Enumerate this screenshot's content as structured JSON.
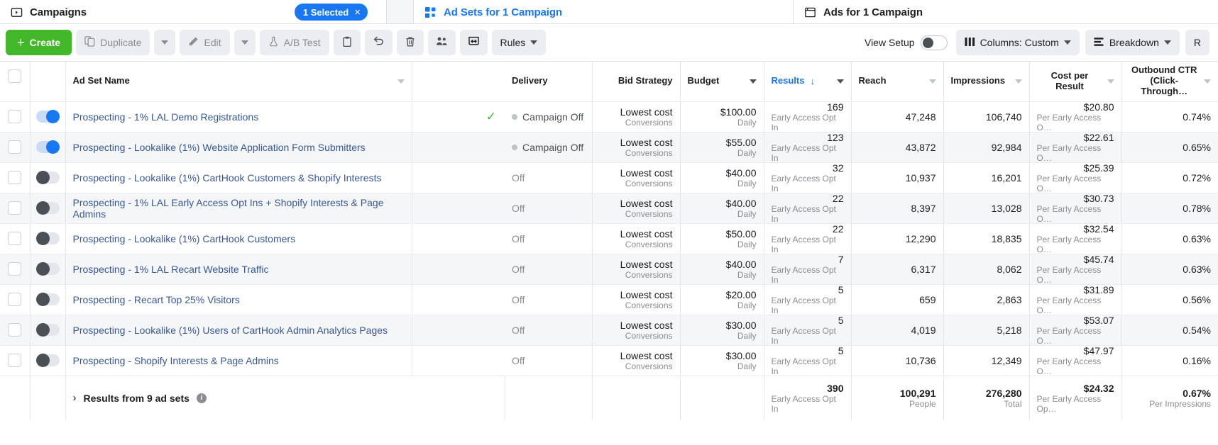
{
  "tabs": [
    {
      "id": "campaigns",
      "label": "Campaigns",
      "icon": "campaigns-icon",
      "selected_badge": "1 Selected",
      "close": "×"
    },
    {
      "id": "adsets",
      "label": "Ad Sets for 1 Campaign",
      "icon": "adsets-grid-icon"
    },
    {
      "id": "ads",
      "label": "Ads for 1 Campaign",
      "icon": "ads-icon"
    }
  ],
  "toolbar": {
    "create_label": "Create",
    "duplicate_label": "Duplicate",
    "edit_label": "Edit",
    "abtest_label": "A/B Test",
    "rules_label": "Rules",
    "icons": {
      "duplicate": "duplicate-icon",
      "edit": "pencil-icon",
      "abtest": "flask-icon",
      "clipboard": "clipboard-icon",
      "revert": "undo-arrow-icon",
      "delete": "trash-icon",
      "audience": "audience-icon",
      "export": "export-icon"
    },
    "view_setup_label": "View Setup",
    "columns_label": "Columns: Custom",
    "breakdown_label": "Breakdown",
    "reports_label": "R"
  },
  "table": {
    "columns": [
      {
        "key": "name",
        "label": "Ad Set Name",
        "align": "left",
        "caret": "dim"
      },
      {
        "key": "delivery",
        "label": "Delivery",
        "align": "left",
        "caret": "none"
      },
      {
        "key": "bid",
        "label": "Bid Strategy",
        "align": "right",
        "caret": "none"
      },
      {
        "key": "budget",
        "label": "Budget",
        "align": "left",
        "caret": "dark"
      },
      {
        "key": "results",
        "label": "Results",
        "align": "left",
        "caret": "dark",
        "sorted": "↓"
      },
      {
        "key": "reach",
        "label": "Reach",
        "align": "left",
        "caret": "dim"
      },
      {
        "key": "impressions",
        "label": "Impressions",
        "align": "left",
        "caret": "dim"
      },
      {
        "key": "cpr",
        "label": "Cost per Result",
        "align": "left",
        "caret": "dim"
      },
      {
        "key": "ctr",
        "label": "Outbound CTR (Click-Through…",
        "align": "left",
        "caret": "dim"
      }
    ],
    "rows": [
      {
        "toggle": "on",
        "checked": true,
        "name": "Prospecting - 1% LAL Demo Registrations",
        "delivery": "Campaign Off",
        "delivery_dot": true,
        "bid": "Lowest cost",
        "bid_sub": "Conversions",
        "budget": "$100.00",
        "budget_sub": "Daily",
        "results": "169",
        "results_sub": "Early Access Opt In",
        "reach": "47,248",
        "impressions": "106,740",
        "cpr": "$20.80",
        "cpr_sub": "Per Early Access O…",
        "ctr": "0.74%"
      },
      {
        "toggle": "on",
        "checked": false,
        "name": "Prospecting - Lookalike (1%) Website Application Form Submitters",
        "delivery": "Campaign Off",
        "delivery_dot": true,
        "bid": "Lowest cost",
        "bid_sub": "Conversions",
        "budget": "$55.00",
        "budget_sub": "Daily",
        "results": "123",
        "results_sub": "Early Access Opt In",
        "reach": "43,872",
        "impressions": "92,984",
        "cpr": "$22.61",
        "cpr_sub": "Per Early Access O…",
        "ctr": "0.65%"
      },
      {
        "toggle": "off",
        "checked": false,
        "name": "Prospecting - Lookalike (1%) CartHook Customers & Shopify Interests",
        "delivery": "Off",
        "delivery_dot": false,
        "bid": "Lowest cost",
        "bid_sub": "Conversions",
        "budget": "$40.00",
        "budget_sub": "Daily",
        "results": "32",
        "results_sub": "Early Access Opt In",
        "reach": "10,937",
        "impressions": "16,201",
        "cpr": "$25.39",
        "cpr_sub": "Per Early Access O…",
        "ctr": "0.72%"
      },
      {
        "toggle": "off",
        "checked": false,
        "name": "Prospecting - 1% LAL Early Access Opt Ins + Shopify Interests & Page Admins",
        "delivery": "Off",
        "delivery_dot": false,
        "bid": "Lowest cost",
        "bid_sub": "Conversions",
        "budget": "$40.00",
        "budget_sub": "Daily",
        "results": "22",
        "results_sub": "Early Access Opt In",
        "reach": "8,397",
        "impressions": "13,028",
        "cpr": "$30.73",
        "cpr_sub": "Per Early Access O…",
        "ctr": "0.78%"
      },
      {
        "toggle": "off",
        "checked": false,
        "name": "Prospecting - Lookalike (1%) CartHook Customers",
        "delivery": "Off",
        "delivery_dot": false,
        "bid": "Lowest cost",
        "bid_sub": "Conversions",
        "budget": "$50.00",
        "budget_sub": "Daily",
        "results": "22",
        "results_sub": "Early Access Opt In",
        "reach": "12,290",
        "impressions": "18,835",
        "cpr": "$32.54",
        "cpr_sub": "Per Early Access O…",
        "ctr": "0.63%"
      },
      {
        "toggle": "off",
        "checked": false,
        "name": "Prospecting - 1% LAL Recart Website Traffic",
        "delivery": "Off",
        "delivery_dot": false,
        "bid": "Lowest cost",
        "bid_sub": "Conversions",
        "budget": "$40.00",
        "budget_sub": "Daily",
        "results": "7",
        "results_sub": "Early Access Opt In",
        "reach": "6,317",
        "impressions": "8,062",
        "cpr": "$45.74",
        "cpr_sub": "Per Early Access O…",
        "ctr": "0.63%"
      },
      {
        "toggle": "off",
        "checked": false,
        "name": "Prospecting - Recart Top 25% Visitors",
        "delivery": "Off",
        "delivery_dot": false,
        "bid": "Lowest cost",
        "bid_sub": "Conversions",
        "budget": "$20.00",
        "budget_sub": "Daily",
        "results": "5",
        "results_sub": "Early Access Opt In",
        "reach": "659",
        "impressions": "2,863",
        "cpr": "$31.89",
        "cpr_sub": "Per Early Access O…",
        "ctr": "0.56%"
      },
      {
        "toggle": "off",
        "checked": false,
        "name": "Prospecting - Lookalike (1%) Users of CartHook Admin Analytics Pages",
        "delivery": "Off",
        "delivery_dot": false,
        "bid": "Lowest cost",
        "bid_sub": "Conversions",
        "budget": "$30.00",
        "budget_sub": "Daily",
        "results": "5",
        "results_sub": "Early Access Opt In",
        "reach": "4,019",
        "impressions": "5,218",
        "cpr": "$53.07",
        "cpr_sub": "Per Early Access O…",
        "ctr": "0.54%"
      },
      {
        "toggle": "off",
        "checked": false,
        "name": "Prospecting - Shopify Interests & Page Admins",
        "delivery": "Off",
        "delivery_dot": false,
        "bid": "Lowest cost",
        "bid_sub": "Conversions",
        "budget": "$30.00",
        "budget_sub": "Daily",
        "results": "5",
        "results_sub": "Early Access Opt In",
        "reach": "10,736",
        "impressions": "12,349",
        "cpr": "$47.97",
        "cpr_sub": "Per Early Access O…",
        "ctr": "0.16%"
      }
    ],
    "totals": {
      "label": "Results from 9 ad sets",
      "chevron": "›",
      "results": "390",
      "results_sub": "Early Access Opt In",
      "reach": "100,291",
      "reach_sub": "People",
      "impressions": "276,280",
      "impressions_sub": "Total",
      "cpr": "$24.32",
      "cpr_sub": "Per Early Access Op…",
      "ctr": "0.67%",
      "ctr_sub": "Per Impressions"
    }
  },
  "colors": {
    "brand_blue": "#1877f2",
    "link_blue": "#385898",
    "create_green": "#42b72a",
    "check_green": "#42b72a",
    "muted": "#8a8d91"
  }
}
